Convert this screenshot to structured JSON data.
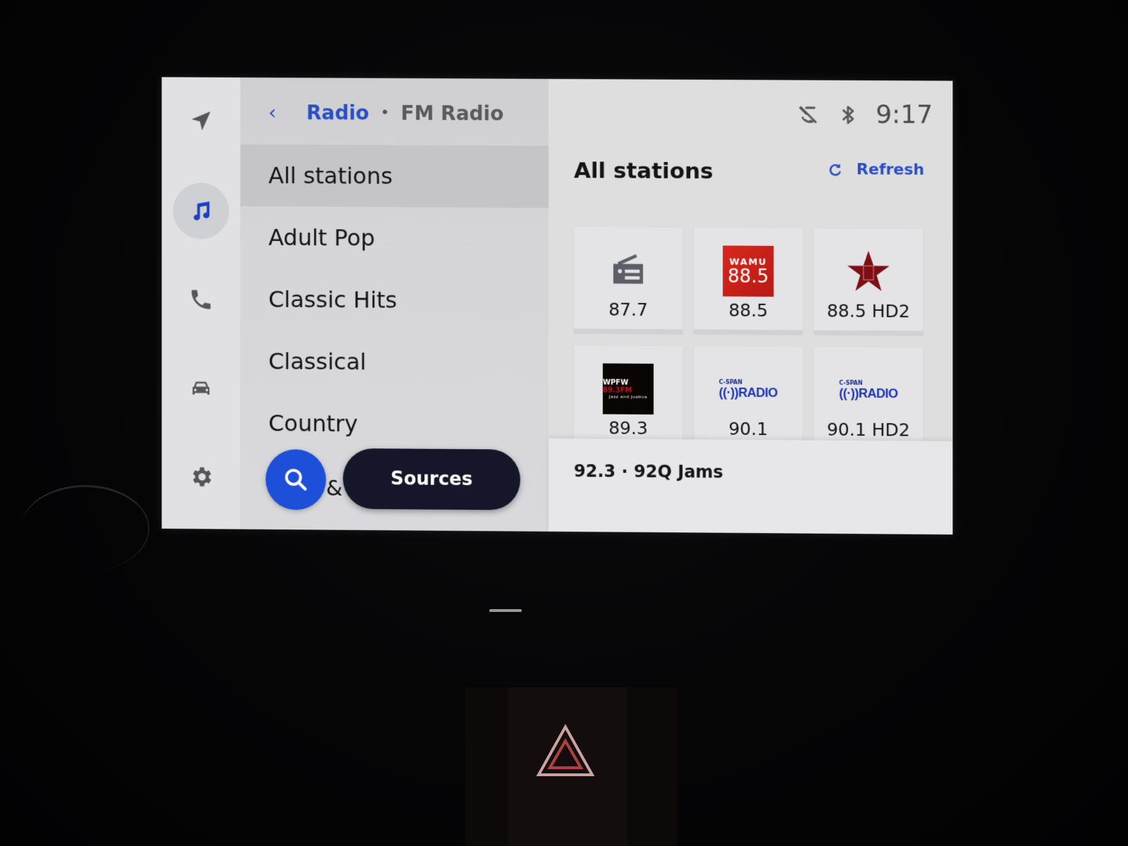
{
  "nav_rail": {
    "items": [
      {
        "name": "navigation",
        "icon": "navigation-arrow-icon",
        "active": false
      },
      {
        "name": "media",
        "icon": "music-note-icon",
        "active": true
      },
      {
        "name": "phone",
        "icon": "phone-icon",
        "active": false
      },
      {
        "name": "vehicle",
        "icon": "car-icon",
        "active": false
      },
      {
        "name": "settings",
        "icon": "gear-icon",
        "active": false
      }
    ]
  },
  "breadcrumb": {
    "back_icon": "chevron-left-icon",
    "parent": "Radio",
    "separator": "•",
    "current": "FM Radio"
  },
  "categories": [
    {
      "label": "All stations",
      "selected": true
    },
    {
      "label": "Adult Pop",
      "selected": false
    },
    {
      "label": "Classic Hits",
      "selected": false
    },
    {
      "label": "Classical",
      "selected": false
    },
    {
      "label": "Country",
      "selected": false
    }
  ],
  "actions": {
    "search_icon": "search-icon",
    "ampersand": "&",
    "sources_label": "Sources"
  },
  "status_bar": {
    "icons": [
      "microphone-off-icon",
      "bluetooth-icon"
    ],
    "time": "9:17"
  },
  "content": {
    "title": "All stations",
    "refresh_label": "Refresh",
    "refresh_icon": "refresh-icon",
    "stations": [
      {
        "freq": "87.7",
        "logo": "radio-icon"
      },
      {
        "freq": "88.5",
        "logo": "wamu-logo",
        "logo_text": [
          "WAMU",
          "88.5"
        ]
      },
      {
        "freq": "88.5 HD2",
        "logo": "red-star-logo"
      },
      {
        "freq": "89.3",
        "logo": "wpfw-logo",
        "logo_text": [
          "WPFW",
          "89.3FM",
          "Jazz and Justice"
        ]
      },
      {
        "freq": "90.1",
        "logo": "cspan-radio-logo",
        "logo_text": [
          "C-SPAN",
          "RADIO"
        ]
      },
      {
        "freq": "90.1 HD2",
        "logo": "cspan-radio-logo",
        "logo_text": [
          "C-SPAN",
          "RADIO"
        ]
      }
    ]
  },
  "now_playing": {
    "text": "92.3 · 92Q Jams"
  },
  "colors": {
    "accent": "#1d4fd8",
    "link": "#2a4fc4",
    "sources_button": "#16162a",
    "wamu_red": "#d7261e"
  }
}
